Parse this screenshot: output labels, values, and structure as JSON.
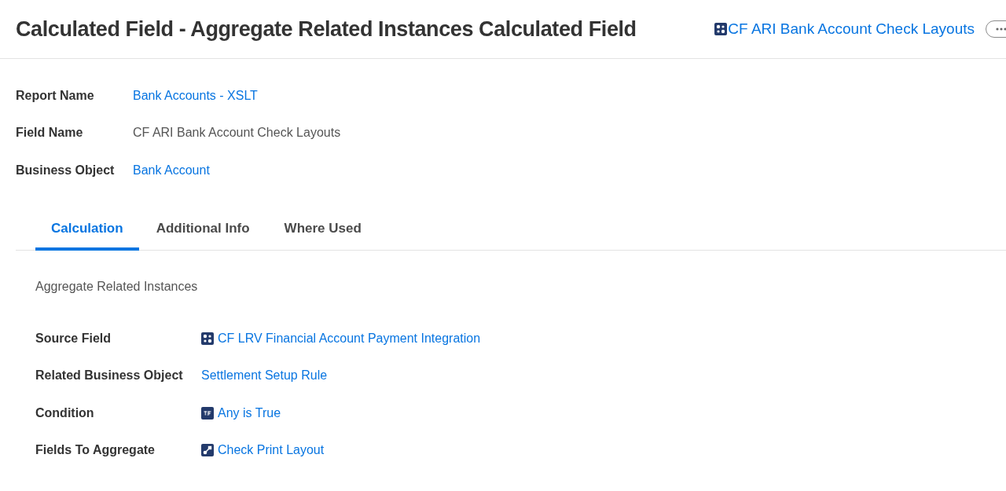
{
  "header": {
    "title": "Calculated Field - Aggregate Related Instances Calculated Field",
    "link": {
      "text": "CF ARI Bank Account Check Layouts",
      "kind": "calculated"
    }
  },
  "details": [
    {
      "label": "Report Name",
      "value": "Bank Accounts - XSLT",
      "link": true
    },
    {
      "label": "Field Name",
      "value": "CF ARI Bank Account Check Layouts",
      "link": false
    },
    {
      "label": "Business Object",
      "value": "Bank Account",
      "link": true
    }
  ],
  "tabs": [
    {
      "label": "Calculation",
      "selected": true
    },
    {
      "label": "Additional Info",
      "selected": false
    },
    {
      "label": "Where Used",
      "selected": false
    }
  ],
  "calculation": {
    "heading": "Aggregate Related Instances",
    "rows": [
      {
        "label": "Source Field",
        "value": "CF LRV Financial Account Payment Integration",
        "kind": "calculated"
      },
      {
        "label": "Related Business Object",
        "value": "Settlement Setup Rule",
        "kind": "plain"
      },
      {
        "label": "Condition",
        "value": "Any is True",
        "kind": "boolean"
      },
      {
        "label": "Fields To Aggregate",
        "value": "Check Print Layout",
        "kind": "instance"
      }
    ]
  }
}
